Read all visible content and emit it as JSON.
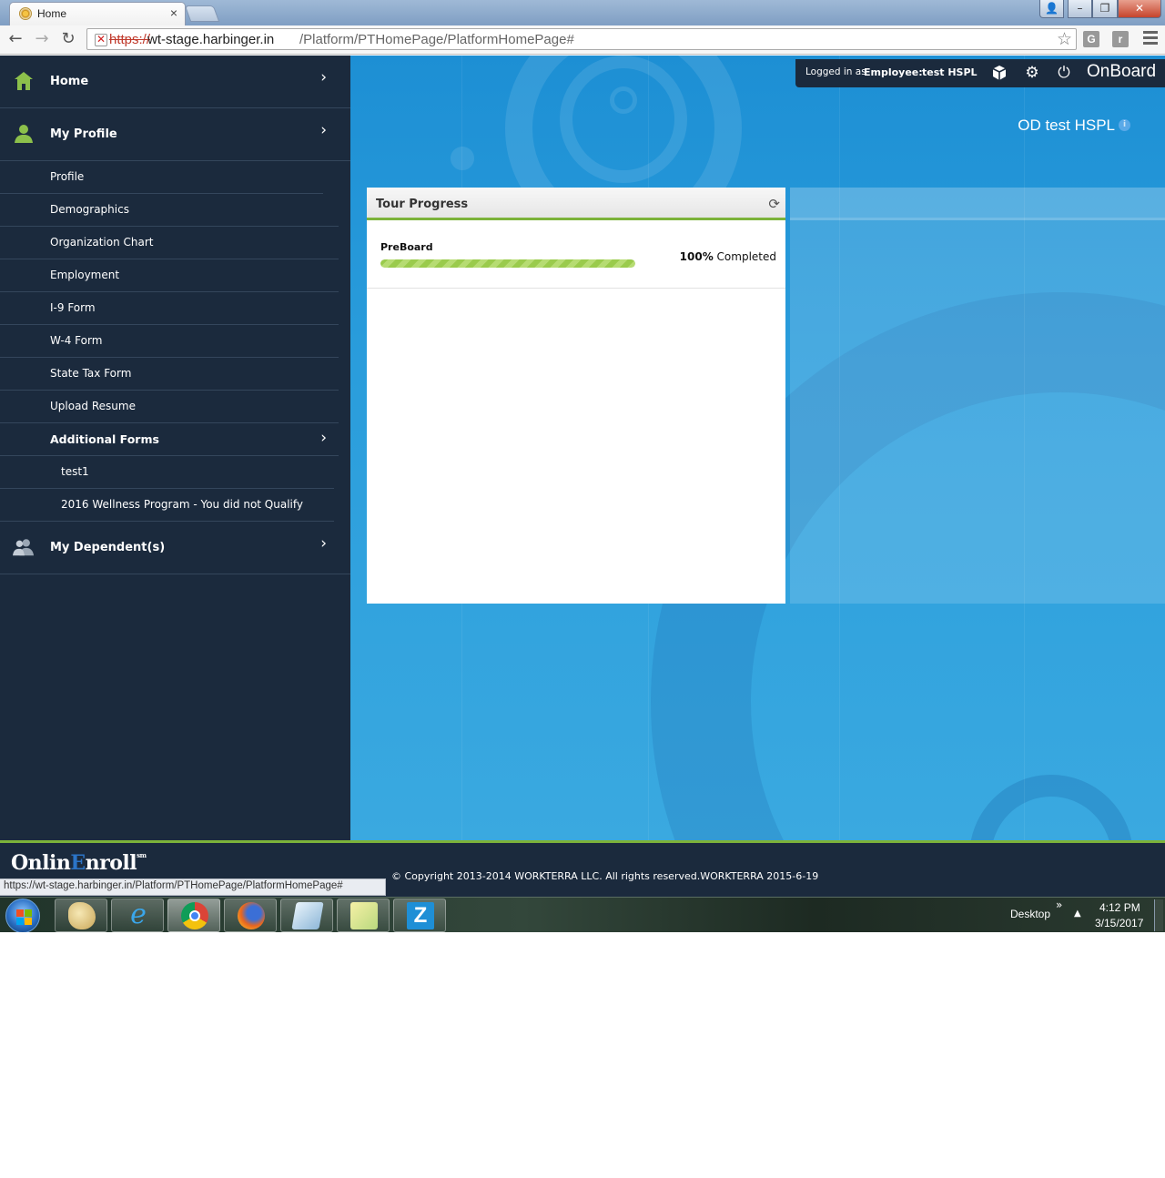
{
  "browser": {
    "tab_title": "Home",
    "tab_close": "×",
    "url_scheme": "https://",
    "url_host": "wt-stage.harbinger.in",
    "url_path": "/Platform/PTHomePage/PlatformHomePage#",
    "ext1": "G",
    "ext2": "r",
    "win_user": "👤",
    "win_min": "–",
    "win_max": "❐",
    "win_close": "✕",
    "back": "←",
    "forward": "→",
    "reload": "↻",
    "star": "☆"
  },
  "sidebar": {
    "items": [
      {
        "label": "Home",
        "icon": "home-icon"
      },
      {
        "label": "My Profile",
        "icon": "person-icon"
      },
      {
        "label": "Profile"
      },
      {
        "label": "Demographics"
      },
      {
        "label": "Organization Chart"
      },
      {
        "label": "Employment"
      },
      {
        "label": "I-9 Form"
      },
      {
        "label": "W-4 Form"
      },
      {
        "label": "State Tax Form"
      },
      {
        "label": "Upload Resume"
      },
      {
        "label": "Additional Forms"
      },
      {
        "label": "test1"
      },
      {
        "label": "2016 Wellness Program - You did not Qualify"
      },
      {
        "label": "My Dependent(s)",
        "icon": "people-icon"
      }
    ],
    "chevron": "›"
  },
  "header": {
    "logged_in_prefix": "Logged in as",
    "logged_in_role": "Employee:",
    "logged_in_user": "test HSPL",
    "brand": "OnBoard",
    "company": "OD test HSPL",
    "info": "i"
  },
  "tour": {
    "title": "Tour Progress",
    "refresh": "⟳",
    "stage": "PreBoard",
    "percent": "100",
    "percent_sign": "%",
    "completed": "Completed",
    "progress_fraction": 1.0
  },
  "colors": {
    "sidebar_bg": "#1b2a3d",
    "accent_green": "#7cb33a",
    "main_blue": "#2a9ddc"
  },
  "footer": {
    "logo_pre": "Onlin",
    "logo_e": "E",
    "logo_post": "nroll",
    "logo_sm": "sm",
    "copyright": "© Copyright 2013-2014 WORKTERRA LLC. All rights reserved.WORKTERRA 2015-6-19",
    "status_url": "https://wt-stage.harbinger.in/Platform/PTHomePage/PlatformHomePage#"
  },
  "taskbar": {
    "desktop": "Desktop",
    "desk_chev": "»",
    "tray_up": "▲",
    "time": "4:12 PM",
    "date": "3/15/2017",
    "z_label": "Z"
  }
}
